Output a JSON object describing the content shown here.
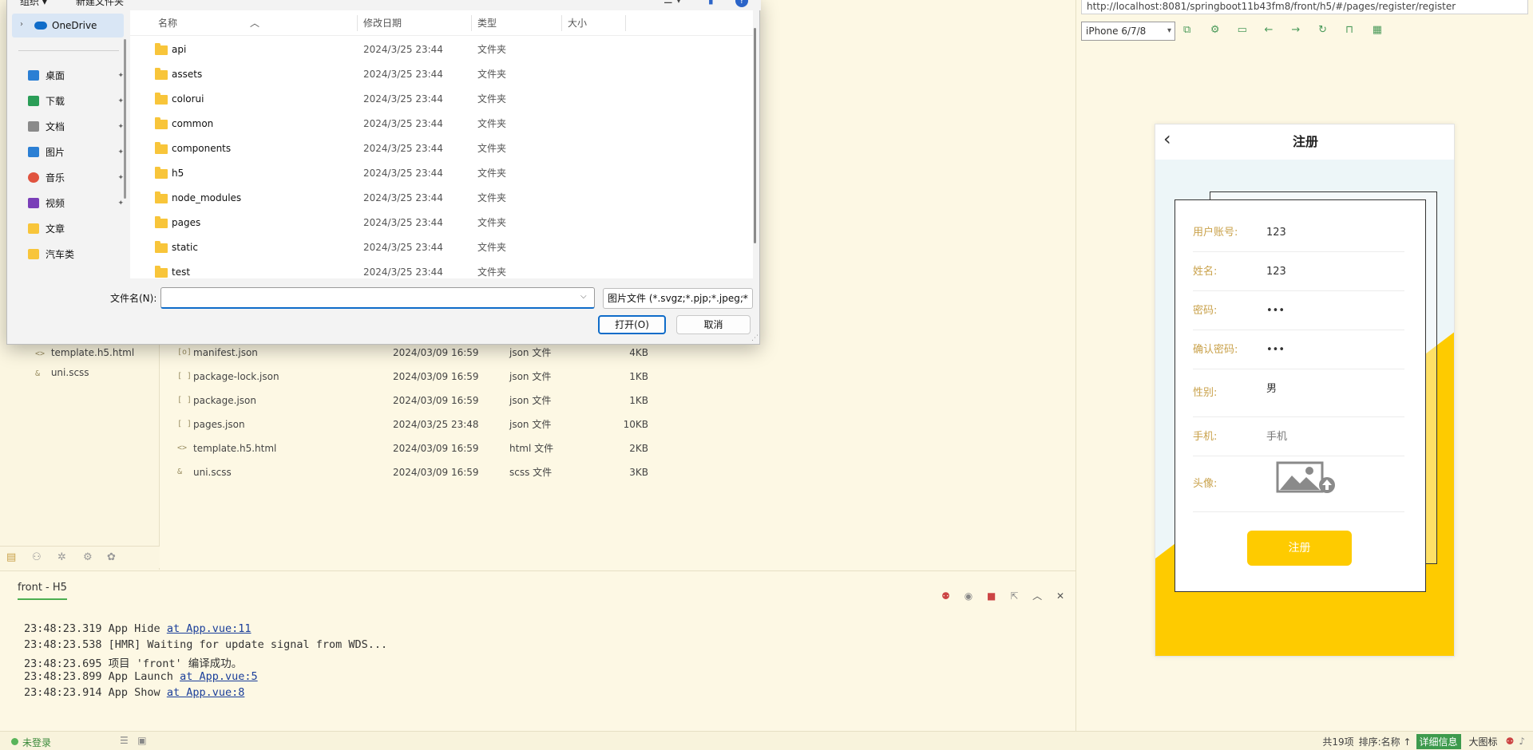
{
  "ide": {
    "tree_items": [
      {
        "icon": "<>",
        "label": "template.h5.html"
      },
      {
        "icon": "&",
        "label": "uni.scss"
      }
    ],
    "files": [
      {
        "icon": "[o]",
        "name": "manifest.json",
        "date": "2024/03/09 16:59",
        "type": "json 文件",
        "size": "4KB"
      },
      {
        "icon": "[ ]",
        "name": "package-lock.json",
        "date": "2024/03/09 16:59",
        "type": "json 文件",
        "size": "1KB"
      },
      {
        "icon": "[ ]",
        "name": "package.json",
        "date": "2024/03/09 16:59",
        "type": "json 文件",
        "size": "1KB"
      },
      {
        "icon": "[ ]",
        "name": "pages.json",
        "date": "2024/03/25 23:48",
        "type": "json 文件",
        "size": "10KB"
      },
      {
        "icon": "<>",
        "name": "template.h5.html",
        "date": "2024/03/09 16:59",
        "type": "html 文件",
        "size": "2KB"
      },
      {
        "icon": "&",
        "name": "uni.scss",
        "date": "2024/03/09 16:59",
        "type": "scss 文件",
        "size": "3KB"
      }
    ]
  },
  "console": {
    "tab": "front - H5",
    "lines": [
      {
        "text": "23:48:23.319 App Hide  ",
        "link": "at App.vue:11"
      },
      {
        "text": "23:48:23.538 [HMR] Waiting for update signal from WDS...",
        "link": ""
      },
      {
        "text": "23:48:23.695 项目 'front' 编译成功。",
        "link": ""
      },
      {
        "text": "23:48:23.899 App Launch  ",
        "link": "at App.vue:5"
      },
      {
        "text": "23:48:23.914 App Show  ",
        "link": "at App.vue:8"
      }
    ]
  },
  "status": {
    "login": "未登录",
    "count": "共19项",
    "sort": "排序:名称 ↑",
    "detail": "详细信息",
    "large": "大图标"
  },
  "preview": {
    "url": "http://localhost:8081/springboot11b43fm8/front/h5/#/pages/register/register",
    "device": "iPhone 6/7/8",
    "page_title": "注册",
    "fields": [
      {
        "label": "用户账号:",
        "value": "123",
        "placeholder": false
      },
      {
        "label": "姓名:",
        "value": "123",
        "placeholder": false
      },
      {
        "label": "密码:",
        "value": "•••",
        "placeholder": false
      },
      {
        "label": "确认密码:",
        "value": "•••",
        "placeholder": false
      },
      {
        "label": "性别:",
        "value": "男",
        "placeholder": false
      },
      {
        "label": "手机:",
        "value": "手机",
        "placeholder": true
      }
    ],
    "avatar_label": "头像:",
    "submit": "注册",
    "accent_color": "#fecb00",
    "label_color": "#c9a14a"
  },
  "dialog": {
    "toolbar": {
      "organize": "组织 ▾",
      "new_folder": "新建文件夹"
    },
    "nav": {
      "onedrive": "OneDrive",
      "items": [
        {
          "label": "桌面",
          "icon": "desktop-icon",
          "color": "#2b7fd4",
          "pinned": true
        },
        {
          "label": "下载",
          "icon": "download-icon",
          "color": "#2a9d57",
          "pinned": true
        },
        {
          "label": "文档",
          "icon": "document-icon",
          "color": "#8a8a8a",
          "pinned": true
        },
        {
          "label": "图片",
          "icon": "picture-icon",
          "color": "#2b7fd4",
          "pinned": true
        },
        {
          "label": "音乐",
          "icon": "music-icon",
          "color": "#e0533f",
          "pinned": true
        },
        {
          "label": "视频",
          "icon": "video-icon",
          "color": "#7a3fb8",
          "pinned": true
        },
        {
          "label": "文章",
          "icon": "folder-icon",
          "color": "#f8c53a",
          "pinned": false
        },
        {
          "label": "汽车类",
          "icon": "folder-icon",
          "color": "#f8c53a",
          "pinned": false
        }
      ]
    },
    "columns": {
      "name": "名称",
      "date": "修改日期",
      "type": "类型",
      "size": "大小"
    },
    "folders": [
      {
        "name": "api",
        "date": "2024/3/25 23:44",
        "type": "文件夹"
      },
      {
        "name": "assets",
        "date": "2024/3/25 23:44",
        "type": "文件夹"
      },
      {
        "name": "colorui",
        "date": "2024/3/25 23:44",
        "type": "文件夹"
      },
      {
        "name": "common",
        "date": "2024/3/25 23:44",
        "type": "文件夹"
      },
      {
        "name": "components",
        "date": "2024/3/25 23:44",
        "type": "文件夹"
      },
      {
        "name": "h5",
        "date": "2024/3/25 23:44",
        "type": "文件夹"
      },
      {
        "name": "node_modules",
        "date": "2024/3/25 23:44",
        "type": "文件夹"
      },
      {
        "name": "pages",
        "date": "2024/3/25 23:44",
        "type": "文件夹"
      },
      {
        "name": "static",
        "date": "2024/3/25 23:44",
        "type": "文件夹"
      },
      {
        "name": "test",
        "date": "2024/3/25 23:44",
        "type": "文件夹"
      }
    ],
    "filename_label": "文件名(N):",
    "filename_value": "",
    "filter": "图片文件 (*.svgz;*.pjp;*.jpeg;*",
    "open": "打开(O)",
    "cancel": "取消"
  }
}
